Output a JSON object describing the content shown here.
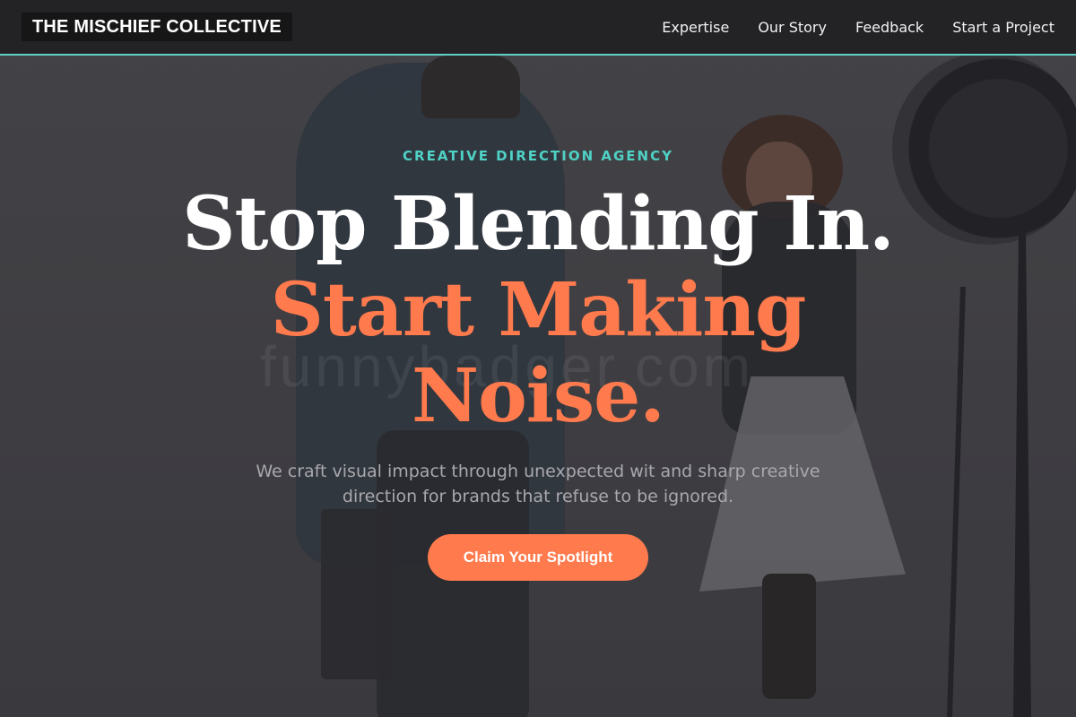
{
  "brand": {
    "name": "THE MISCHIEF COLLECTIVE"
  },
  "nav": {
    "items": [
      {
        "label": "Expertise"
      },
      {
        "label": "Our Story"
      },
      {
        "label": "Feedback"
      },
      {
        "label": "Start a Project"
      }
    ]
  },
  "hero": {
    "eyebrow": "CREATIVE DIRECTION AGENCY",
    "headline_line1": "Stop Blending In.",
    "headline_line2": "Start Making Noise.",
    "subtext": "We craft visual impact through unexpected wit and sharp creative direction for brands that refuse to be ignored.",
    "cta_label": "Claim Your Spotlight",
    "background_image": "photographer shooting a smiling model in a studio with a studio light"
  },
  "watermark": "funnybadger.com",
  "colors": {
    "accent_orange": "#ff7a4d",
    "accent_teal": "#4fd1c5",
    "nav_background": "#222224",
    "brand_background": "#161617"
  }
}
